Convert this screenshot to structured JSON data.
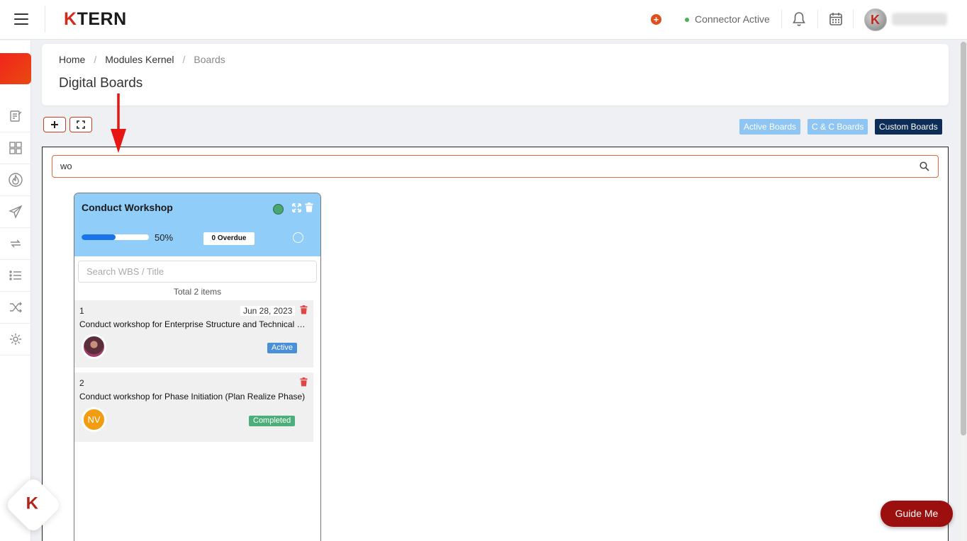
{
  "topbar": {
    "logo_prefix": "K",
    "logo_rest": "TERN",
    "connector_status": "Connector Active"
  },
  "breadcrumb": {
    "items": [
      "Home",
      "Modules Kernel",
      "Boards"
    ]
  },
  "page": {
    "title": "Digital Boards"
  },
  "toolbar": {
    "add_label": "+",
    "tabs": [
      {
        "label": "Active Boards",
        "color": "#8ec5f2"
      },
      {
        "label": "C & C Boards",
        "color": "#8ec5f2"
      },
      {
        "label": "Custom Boards",
        "color": "#0d2d57"
      }
    ]
  },
  "search": {
    "value": "wo"
  },
  "board": {
    "title": "Conduct Workshop",
    "progress_percent": 50,
    "progress_label": "50%",
    "overdue_label": "0 Overdue",
    "search_placeholder": "Search WBS / Title",
    "total_label": "Total 2 items",
    "tasks": [
      {
        "num": "1",
        "date": "Jun 28, 2023",
        "title": "Conduct workshop for Enterprise Structure and Technical Setup",
        "avatar_initials": "",
        "status": "Active",
        "status_color": "#4a90d9"
      },
      {
        "num": "2",
        "date": "",
        "title": "Conduct workshop for Phase Initiation (Plan Realize Phase)",
        "avatar_initials": "NV",
        "status": "Completed",
        "status_color": "#4caf7a"
      }
    ]
  },
  "floating": {
    "logo_letter": "K",
    "guide_label": "Guide Me"
  },
  "colors": {
    "accent": "#d42a1a",
    "board_header": "#90cdf8",
    "progress": "#1a73e8"
  }
}
